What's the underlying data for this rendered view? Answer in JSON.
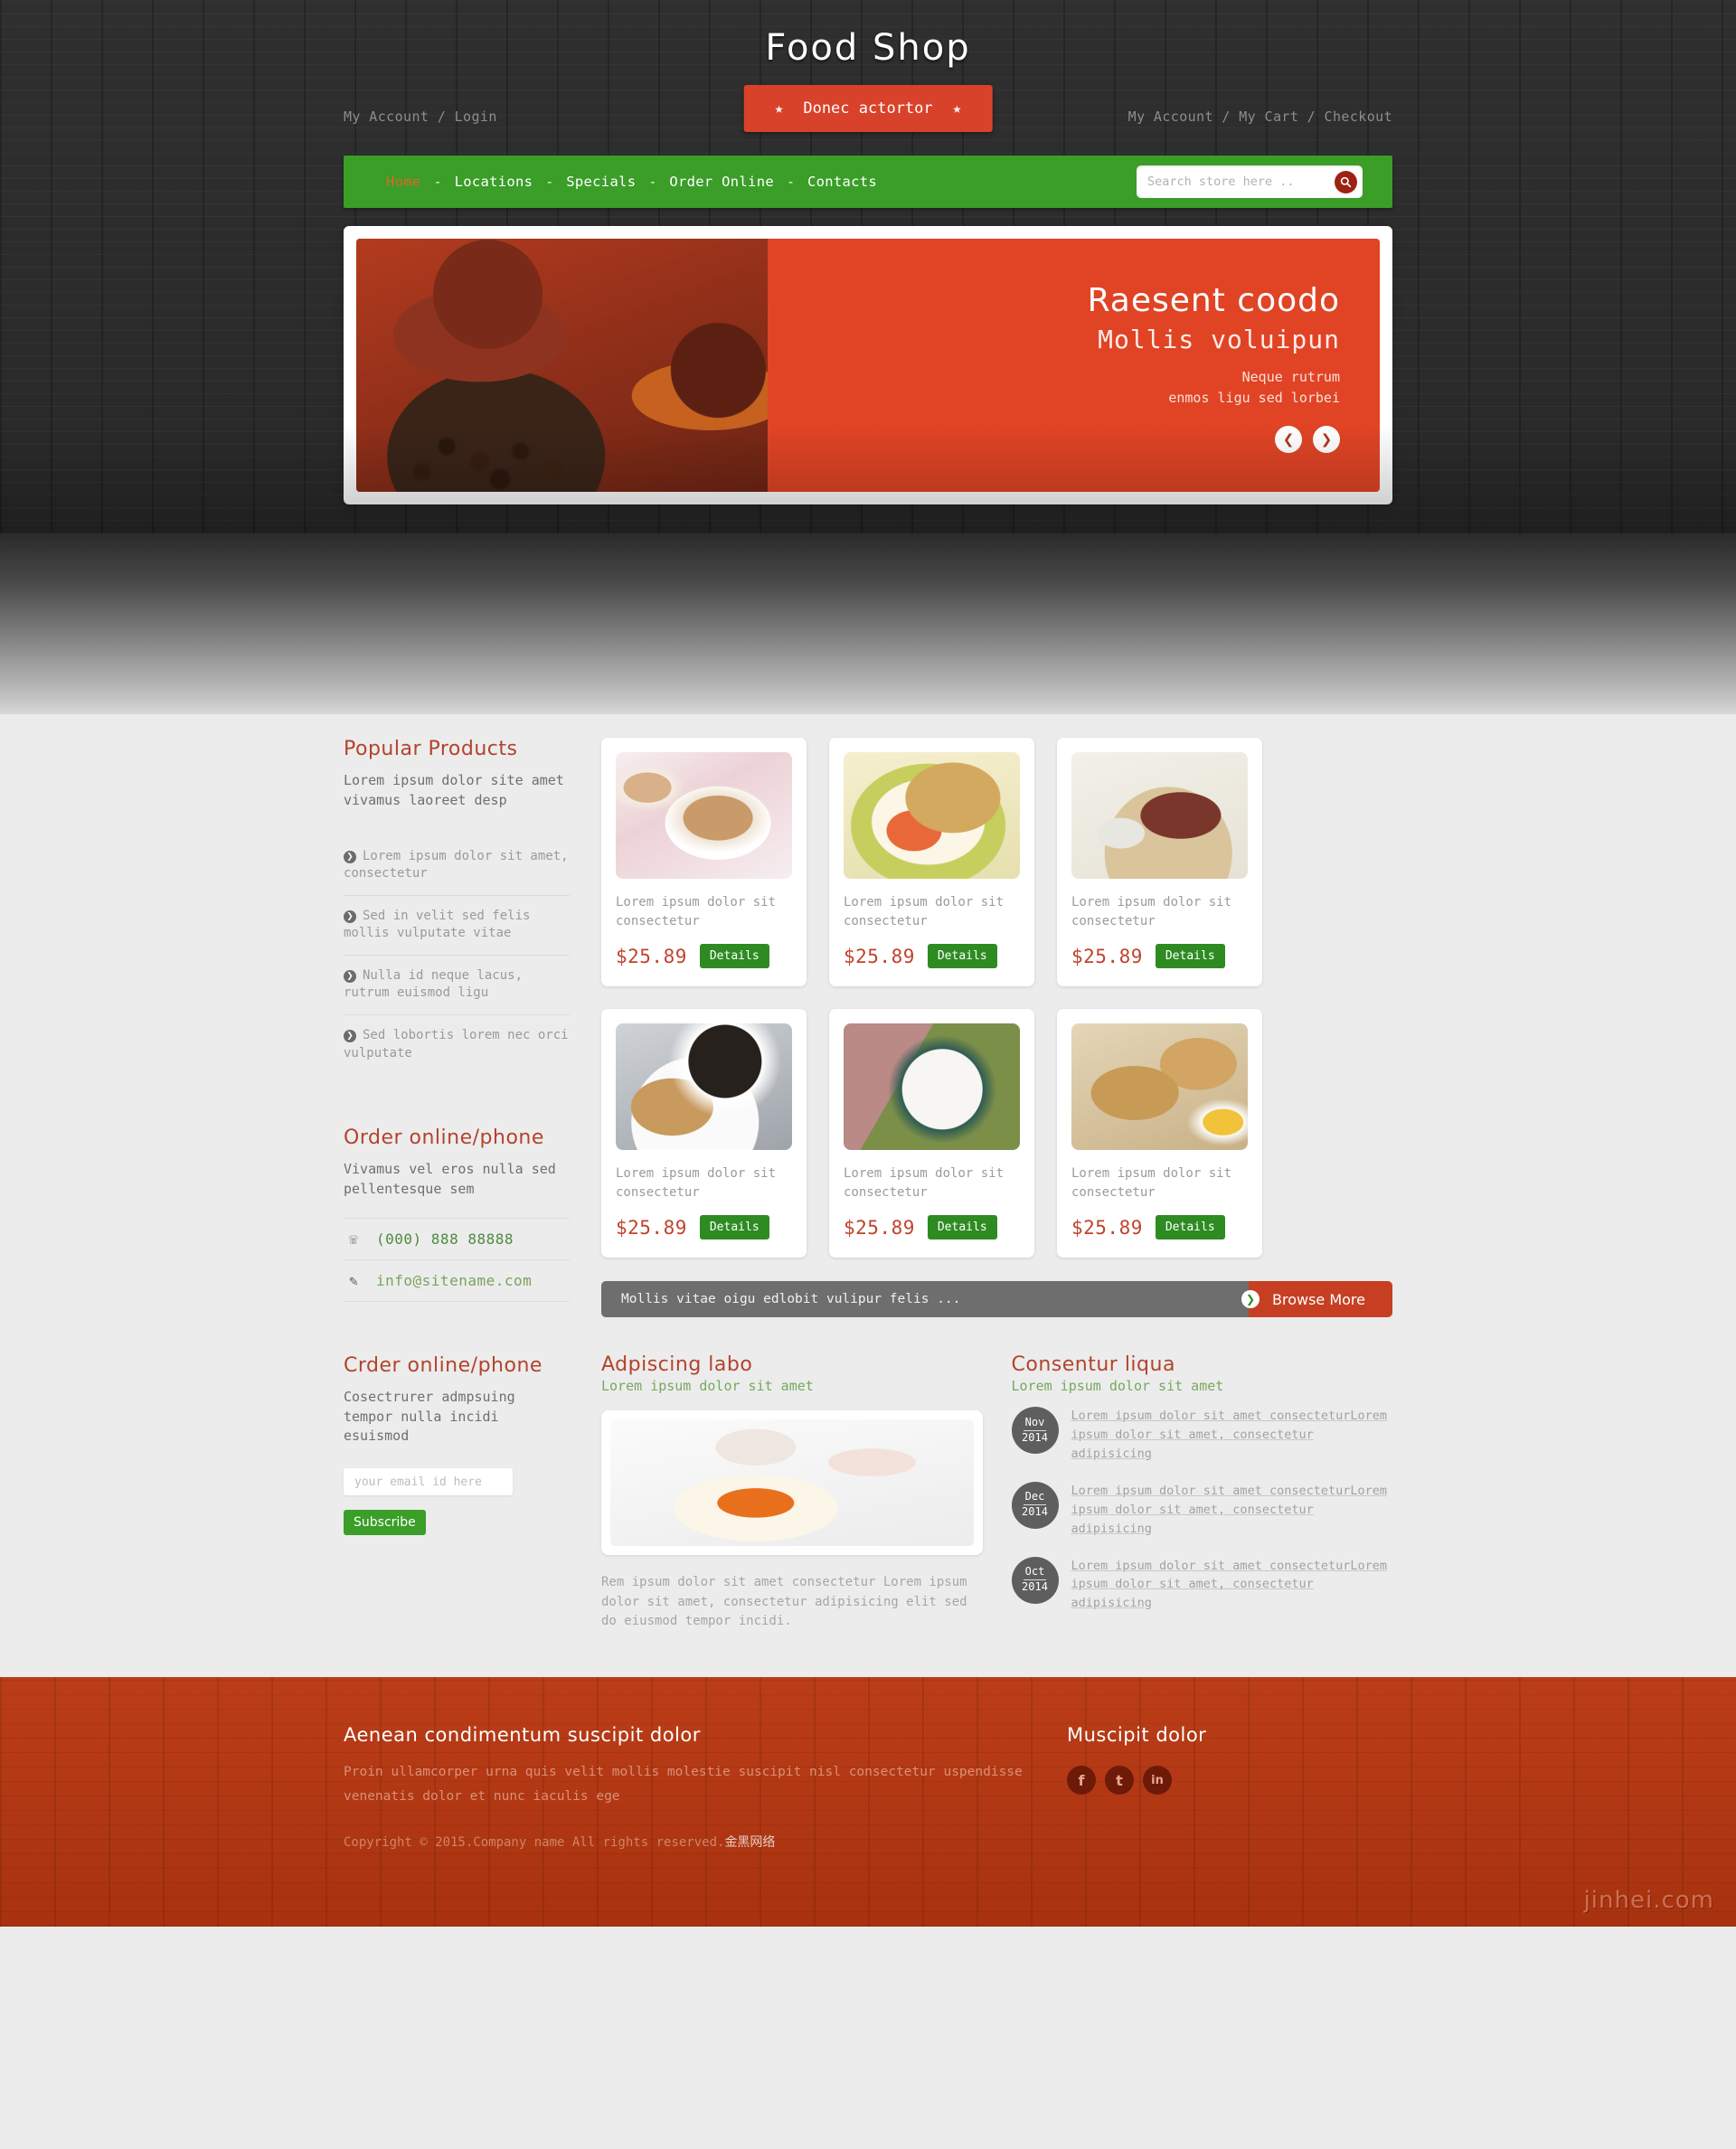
{
  "header": {
    "site_title": "Food Shop",
    "util_left": "My Account / Login",
    "util_right": "My Account / My Cart / Checkout",
    "cta_label": "Donec actortor",
    "star_icon": "star-icon"
  },
  "nav": {
    "items": [
      {
        "label": "Home",
        "active": true
      },
      {
        "label": "Locations",
        "active": false
      },
      {
        "label": "Specials",
        "active": false
      },
      {
        "label": "Order Online",
        "active": false
      },
      {
        "label": "Contacts",
        "active": false
      }
    ],
    "separator": "-",
    "search_placeholder": "Search store here ..",
    "search_value": "",
    "search_icon": "search-icon"
  },
  "hero": {
    "title": "Raesent coodo",
    "subtitle": "Mollis voluipun",
    "line1": "Neque rutrum",
    "line2": "enmos ligu sed lorbei",
    "prev_icon": "chevron-left-icon",
    "next_icon": "chevron-right-icon"
  },
  "sidebar": {
    "popular": {
      "title": "Popular Products",
      "desc": "Lorem ipsum dolor site amet vivamus laoreet desp",
      "items": [
        "Lorem ipsum dolor sit amet, consectetur",
        "Sed in velit sed felis mollis vulputate vitae",
        "Nulla id neque lacus, rutrum euismod ligu",
        "Sed lobortis lorem nec orci vulputate"
      ]
    },
    "order": {
      "title": "Order online/phone",
      "desc": "Vivamus vel eros nulla sed pellentesque sem",
      "phone": "(000) 888 88888",
      "email": "info@sitename.com",
      "phone_icon": "telephone-icon",
      "email_icon": "pencil-icon"
    },
    "newsletter": {
      "title": "Crder online/phone",
      "desc": "Cosectrurer admpsuing tempor nulla incidi esuismod",
      "email_placeholder": "your email id here",
      "email_value": "",
      "subscribe_label": "Subscribe"
    }
  },
  "products": {
    "items": [
      {
        "name": "Lorem ipsum dolor sit consectetur",
        "price": "$25.89",
        "details_label": "Details",
        "img": "p1"
      },
      {
        "name": "Lorem ipsum dolor sit consectetur",
        "price": "$25.89",
        "details_label": "Details",
        "img": "p2"
      },
      {
        "name": "Lorem ipsum dolor sit consectetur",
        "price": "$25.89",
        "details_label": "Details",
        "img": "p3"
      },
      {
        "name": "Lorem ipsum dolor sit consectetur",
        "price": "$25.89",
        "details_label": "Details",
        "img": "p4"
      },
      {
        "name": "Lorem ipsum dolor sit consectetur",
        "price": "$25.89",
        "details_label": "Details",
        "img": "p5"
      },
      {
        "name": "Lorem ipsum dolor sit consectetur",
        "price": "$25.89",
        "details_label": "Details",
        "img": "p6"
      }
    ],
    "browse_message": "Mollis vitae oigu edlobit vulipur felis ...",
    "browse_label": "Browse More",
    "browse_icon": "chevron-right-icon"
  },
  "lower_left": {
    "title": "Adpiscing labo",
    "subtitle": "Lorem ipsum dolor sit amet",
    "body": "Rem ipsum dolor sit amet consectetur Lorem ipsum dolor sit amet, consectetur adipisicing elit sed do eiusmod tempor incidi."
  },
  "lower_right": {
    "title": "Consentur liqua",
    "subtitle": "Lorem ipsum dolor sit amet",
    "news": [
      {
        "month": "Nov",
        "year": "2014",
        "text": "Lorem ipsum dolor sit amet consecteturLorem ipsum dolor sit amet, consectetur adipisicing"
      },
      {
        "month": "Dec",
        "year": "2014",
        "text": "Lorem ipsum dolor sit amet consecteturLorem ipsum dolor sit amet, consectetur adipisicing"
      },
      {
        "month": "Oct",
        "year": "2014",
        "text": "Lorem ipsum dolor sit amet consecteturLorem ipsum dolor sit amet, consectetur adipisicing"
      }
    ]
  },
  "footer": {
    "title": "Aenean condimentum suscipit dolor",
    "body": "Proin ullamcorper urna quis velit mollis molestie suscipit nisl consectetur uspendisse venenatis dolor et nunc iaculis ege",
    "copyright": "Copyright © 2015.Company name All rights reserved.",
    "copyright_cn": "金黑网络",
    "social_title": "Muscipit dolor",
    "socials": [
      {
        "icon": "facebook-icon",
        "glyph": "f"
      },
      {
        "icon": "twitter-icon",
        "glyph": "t"
      },
      {
        "icon": "linkedin-icon",
        "glyph": "in"
      }
    ],
    "watermark": "jinhei.com"
  },
  "colors": {
    "brand_red": "#d9422a",
    "nav_green": "#3a9e28",
    "heading_red": "#b2442c",
    "price_red": "#c0432c",
    "footer_red": "#b53a17"
  }
}
